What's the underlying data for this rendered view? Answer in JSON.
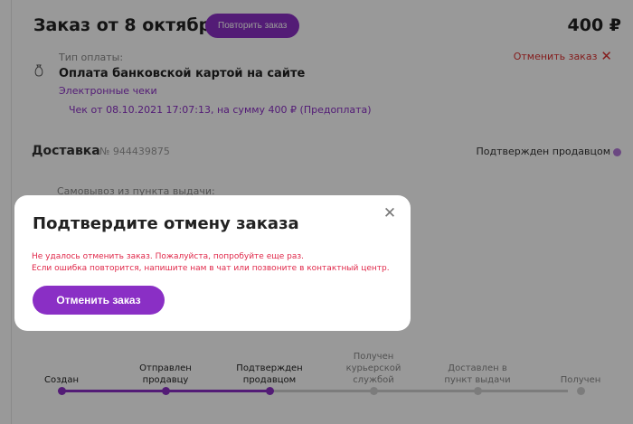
{
  "order": {
    "title": "Заказ от 8 октября",
    "repeat_label": "Повторить заказ",
    "price": "400 ₽"
  },
  "payment": {
    "type_label": "Тип оплаты:",
    "type_value": "Оплата банковской картой на сайте",
    "cancel_label": "Отменить заказ",
    "receipts_label": "Электронные чеки",
    "receipt_line": "Чек от 08.10.2021 17:07:13, на сумму 400 ₽ (Предоплата)"
  },
  "delivery": {
    "title": "Доставка",
    "number": "№ 944439875",
    "status": "Подтвержден продавцом",
    "pickup_label": "Самовывоз из пункта выдачи:"
  },
  "progress": {
    "steps": [
      {
        "label": "Создан",
        "done": true
      },
      {
        "label": "Отправлен продавцу",
        "done": true
      },
      {
        "label": "Подтвержден продавцом",
        "done": true
      },
      {
        "label": "Получен курьерской службой",
        "done": false
      },
      {
        "label": "Доставлен в пункт выдачи",
        "done": false
      },
      {
        "label": "Получен",
        "done": false
      }
    ]
  },
  "modal": {
    "title": "Подтвердите отмену заказа",
    "close_icon": "close-icon",
    "error_line1": "Не удалось отменить заказ. Пожалуйста, попробуйте еще раз.",
    "error_line2": "Если ошибка повторится, напишите нам в чат или позвоните в контактный центр.",
    "confirm_label": "Отменить заказ"
  },
  "colors": {
    "accent": "#8a2fc5",
    "error": "#e0284a",
    "cancel": "#dd3333"
  }
}
